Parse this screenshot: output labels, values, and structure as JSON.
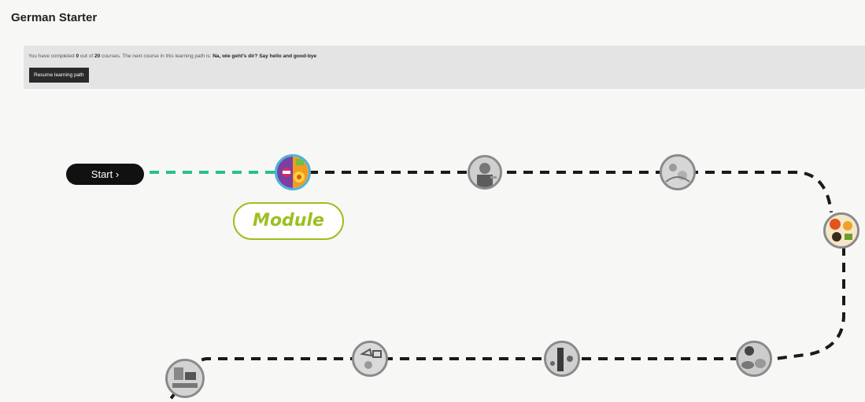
{
  "page": {
    "title": "German Starter"
  },
  "progress": {
    "prefix": "You have completed",
    "completed": "0",
    "middle": "out of",
    "total": "20",
    "suffix": "courses. The next course in this learning path is:",
    "next_course": "Na, wie geht’s dir? Say hello and good-bye",
    "resume_label": "Resume learning path"
  },
  "path": {
    "start_label": "Start ›",
    "module_label": "Module",
    "colors": {
      "completed_dash": "#2bbf8f",
      "pending_dash": "#1a1a1a",
      "active_ring": "#49b3e0",
      "module_label": "#9dbf1e"
    },
    "nodes": [
      {
        "name": "course-node-1",
        "status": "current",
        "icon": "colorful-greeting-thumbnail"
      },
      {
        "name": "course-node-2",
        "status": "locked",
        "icon": "grey-portrait-thumbnail"
      },
      {
        "name": "course-node-3",
        "status": "locked",
        "icon": "grey-sketch-thumbnail"
      },
      {
        "name": "course-node-4",
        "status": "available",
        "icon": "colorful-food-thumbnail"
      },
      {
        "name": "course-node-5",
        "status": "locked",
        "icon": "grey-objects-thumbnail"
      },
      {
        "name": "course-node-6",
        "status": "locked",
        "icon": "grey-figure-thumbnail"
      },
      {
        "name": "course-node-7",
        "status": "locked",
        "icon": "grey-chat-thumbnail"
      },
      {
        "name": "course-node-8",
        "status": "locked",
        "icon": "grey-desk-thumbnail"
      }
    ]
  }
}
